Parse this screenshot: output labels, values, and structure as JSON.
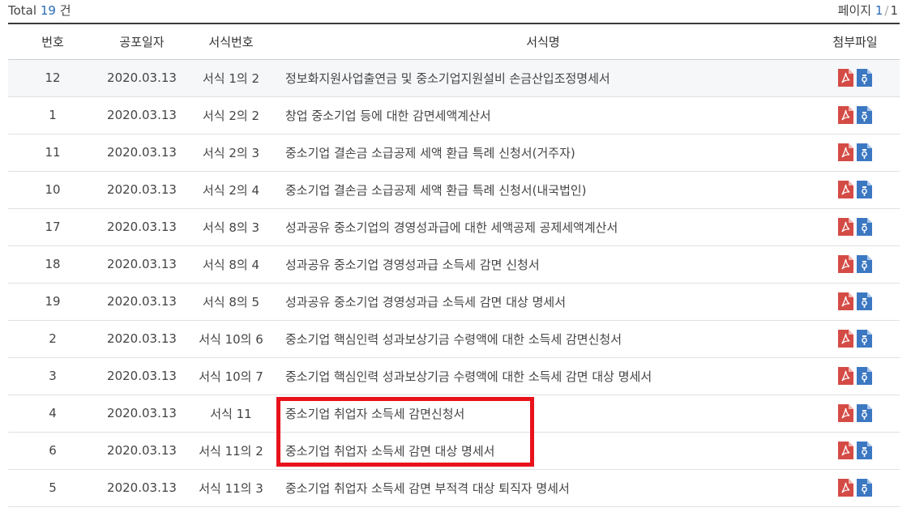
{
  "summary": {
    "total_label": "Total",
    "total_count": "19",
    "total_unit": "건"
  },
  "paging": {
    "label": "페이지",
    "current": "1",
    "separator": "/",
    "total": "1"
  },
  "table": {
    "headers": {
      "no": "번호",
      "date": "공포일자",
      "form_no": "서식번호",
      "form_name": "서식명",
      "attach": "첨부파일"
    },
    "rows": [
      {
        "no": "12",
        "date": "2020.03.13",
        "form_no": "서식 1의 2",
        "title": "정보화지원사업출연금 및 중소기업지원설비 손금산입조정명세서"
      },
      {
        "no": "1",
        "date": "2020.03.13",
        "form_no": "서식 2의 2",
        "title": "창업 중소기업 등에 대한 감면세액계산서"
      },
      {
        "no": "11",
        "date": "2020.03.13",
        "form_no": "서식 2의 3",
        "title": "중소기업 결손금 소급공제 세액 환급 특례 신청서(거주자)"
      },
      {
        "no": "10",
        "date": "2020.03.13",
        "form_no": "서식 2의 4",
        "title": "중소기업 결손금 소급공제 세액 환급 특례 신청서(내국법인)"
      },
      {
        "no": "17",
        "date": "2020.03.13",
        "form_no": "서식 8의 3",
        "title": "성과공유 중소기업의 경영성과급에 대한 세액공제 공제세액계산서"
      },
      {
        "no": "18",
        "date": "2020.03.13",
        "form_no": "서식 8의 4",
        "title": "성과공유 중소기업 경영성과급 소득세 감면 신청서"
      },
      {
        "no": "19",
        "date": "2020.03.13",
        "form_no": "서식 8의 5",
        "title": "성과공유 중소기업 경영성과급 소득세 감면 대상 명세서"
      },
      {
        "no": "2",
        "date": "2020.03.13",
        "form_no": "서식 10의 6",
        "title": "중소기업 핵심인력 성과보상기금 수령액에 대한 소득세 감면신청서"
      },
      {
        "no": "3",
        "date": "2020.03.13",
        "form_no": "서식 10의 7",
        "title": "중소기업 핵심인력 성과보상기금 수령액에 대한 소득세 감면 대상 명세서"
      },
      {
        "no": "4",
        "date": "2020.03.13",
        "form_no": "서식 11",
        "title": "중소기업 취업자 소득세 감면신청서"
      },
      {
        "no": "6",
        "date": "2020.03.13",
        "form_no": "서식 11의 2",
        "title": "중소기업 취업자 소득세 감면 대상 명세서"
      },
      {
        "no": "5",
        "date": "2020.03.13",
        "form_no": "서식 11의 3",
        "title": "중소기업 취업자 소득세 감면 부적격 대상 퇴직자 명세서"
      }
    ],
    "attachment_icons": [
      "pdf-icon",
      "hwp-document-icon"
    ]
  },
  "colors": {
    "pdf": "#d44b45",
    "doc": "#3c78c2",
    "highlight": "#e8121b",
    "accent": "#2a6ab8"
  }
}
